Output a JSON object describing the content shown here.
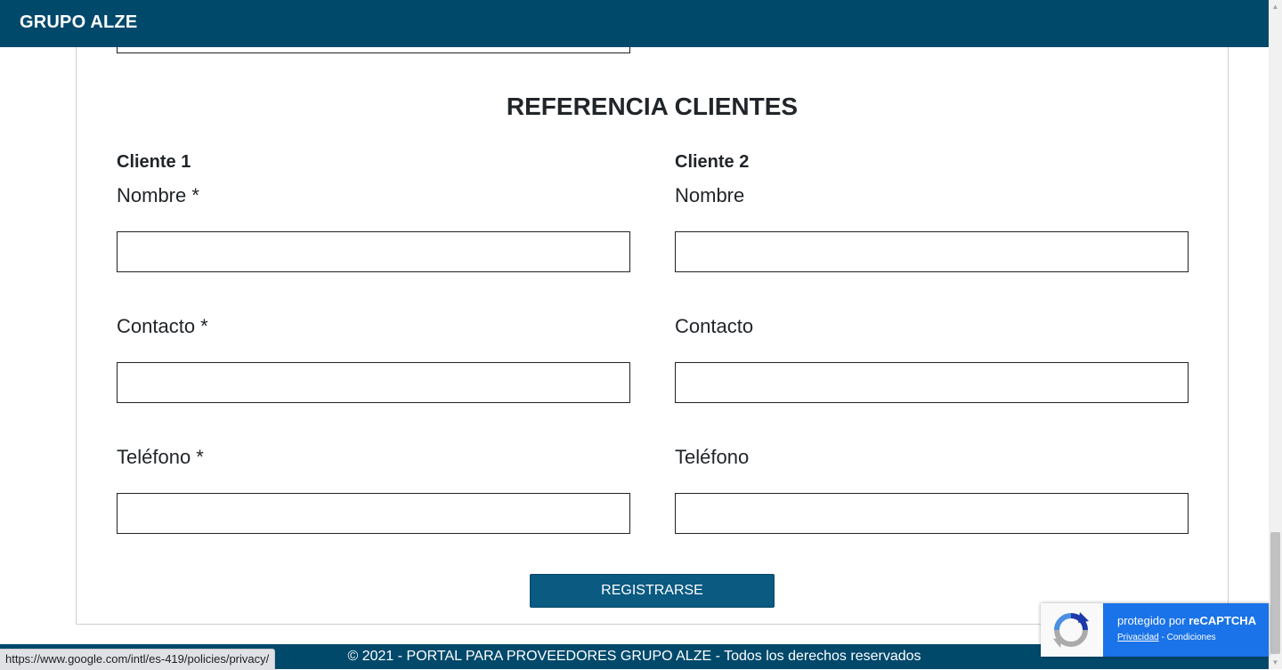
{
  "navbar": {
    "brand": "GRUPO ALZE"
  },
  "section": {
    "title": "REFERENCIA CLIENTES"
  },
  "client1": {
    "title": "Cliente 1",
    "name_label": "Nombre *",
    "contact_label": "Contacto *",
    "phone_label": "Teléfono *",
    "name_value": "",
    "contact_value": "",
    "phone_value": ""
  },
  "client2": {
    "title": "Cliente 2",
    "name_label": "Nombre",
    "contact_label": "Contacto",
    "phone_label": "Teléfono",
    "name_value": "",
    "contact_value": "",
    "phone_value": ""
  },
  "form": {
    "submit_label": "REGISTRARSE"
  },
  "footer": {
    "text": "© 2021 - PORTAL PARA PROVEEDORES GRUPO ALZE - Todos los derechos reservados"
  },
  "status_bar": {
    "url": "https://www.google.com/intl/es-419/policies/privacy/"
  },
  "recaptcha": {
    "protected_prefix": "protegido por ",
    "brand": "reCAPTCHA",
    "privacy": "Privacidad",
    "separator": " - ",
    "terms": "Condiciones"
  },
  "icons": {
    "recaptcha_logo": "recaptcha-logo-icon",
    "scroll_up": "arrow-up-icon",
    "scroll_down": "arrow-down-icon"
  },
  "colors": {
    "brand": "#00496b",
    "button": "#0a5a82",
    "recaptcha_blue": "#1a73e8"
  }
}
